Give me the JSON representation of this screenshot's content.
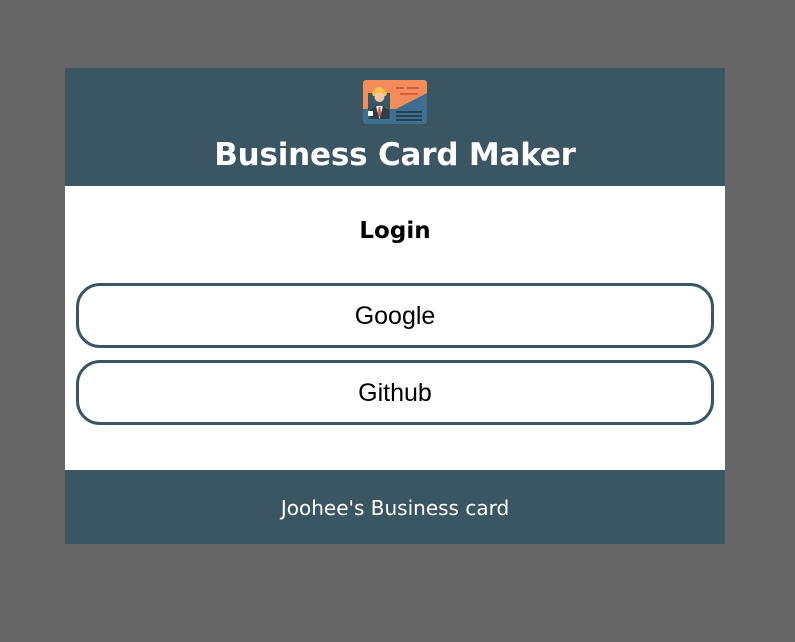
{
  "header": {
    "title": "Business Card Maker",
    "logo_icon": "business-card-icon"
  },
  "login": {
    "title": "Login",
    "providers": [
      {
        "label": "Google"
      },
      {
        "label": "Github"
      }
    ]
  },
  "footer": {
    "text": "Joohee's Business card"
  },
  "colors": {
    "background": "#666666",
    "header_footer": "#3a5663",
    "panel": "#ffffff",
    "button_border": "#3a5663"
  }
}
